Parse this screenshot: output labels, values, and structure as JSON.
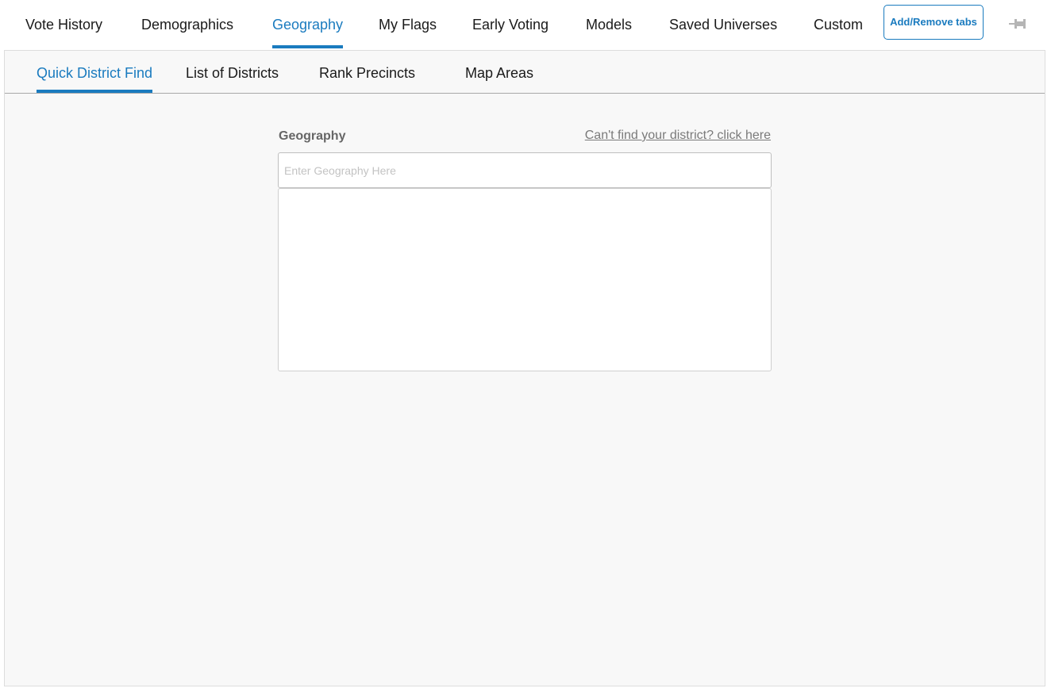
{
  "top_tabs": [
    {
      "label": "Vote History",
      "active": false
    },
    {
      "label": "Demographics",
      "active": false
    },
    {
      "label": "Geography",
      "active": true
    },
    {
      "label": "My Flags",
      "active": false
    },
    {
      "label": "Early Voting",
      "active": false
    },
    {
      "label": "Models",
      "active": false
    },
    {
      "label": "Saved Universes",
      "active": false
    },
    {
      "label": "Custom",
      "active": false
    }
  ],
  "add_remove_label": "Add/Remove tabs",
  "pin_icon": "pin-icon",
  "sub_tabs": [
    {
      "label": "Quick District Find",
      "active": true
    },
    {
      "label": "List of Districts",
      "active": false
    },
    {
      "label": "Rank Precincts",
      "active": false
    },
    {
      "label": "Map Areas",
      "active": false
    }
  ],
  "geography": {
    "label": "Geography",
    "help_link": "Can't find your district? click here",
    "input_value": "",
    "placeholder": "Enter Geography Here",
    "results": []
  },
  "colors": {
    "accent": "#1a7bbf",
    "panel_bg": "#f8f8f8",
    "muted_text": "#666666"
  }
}
